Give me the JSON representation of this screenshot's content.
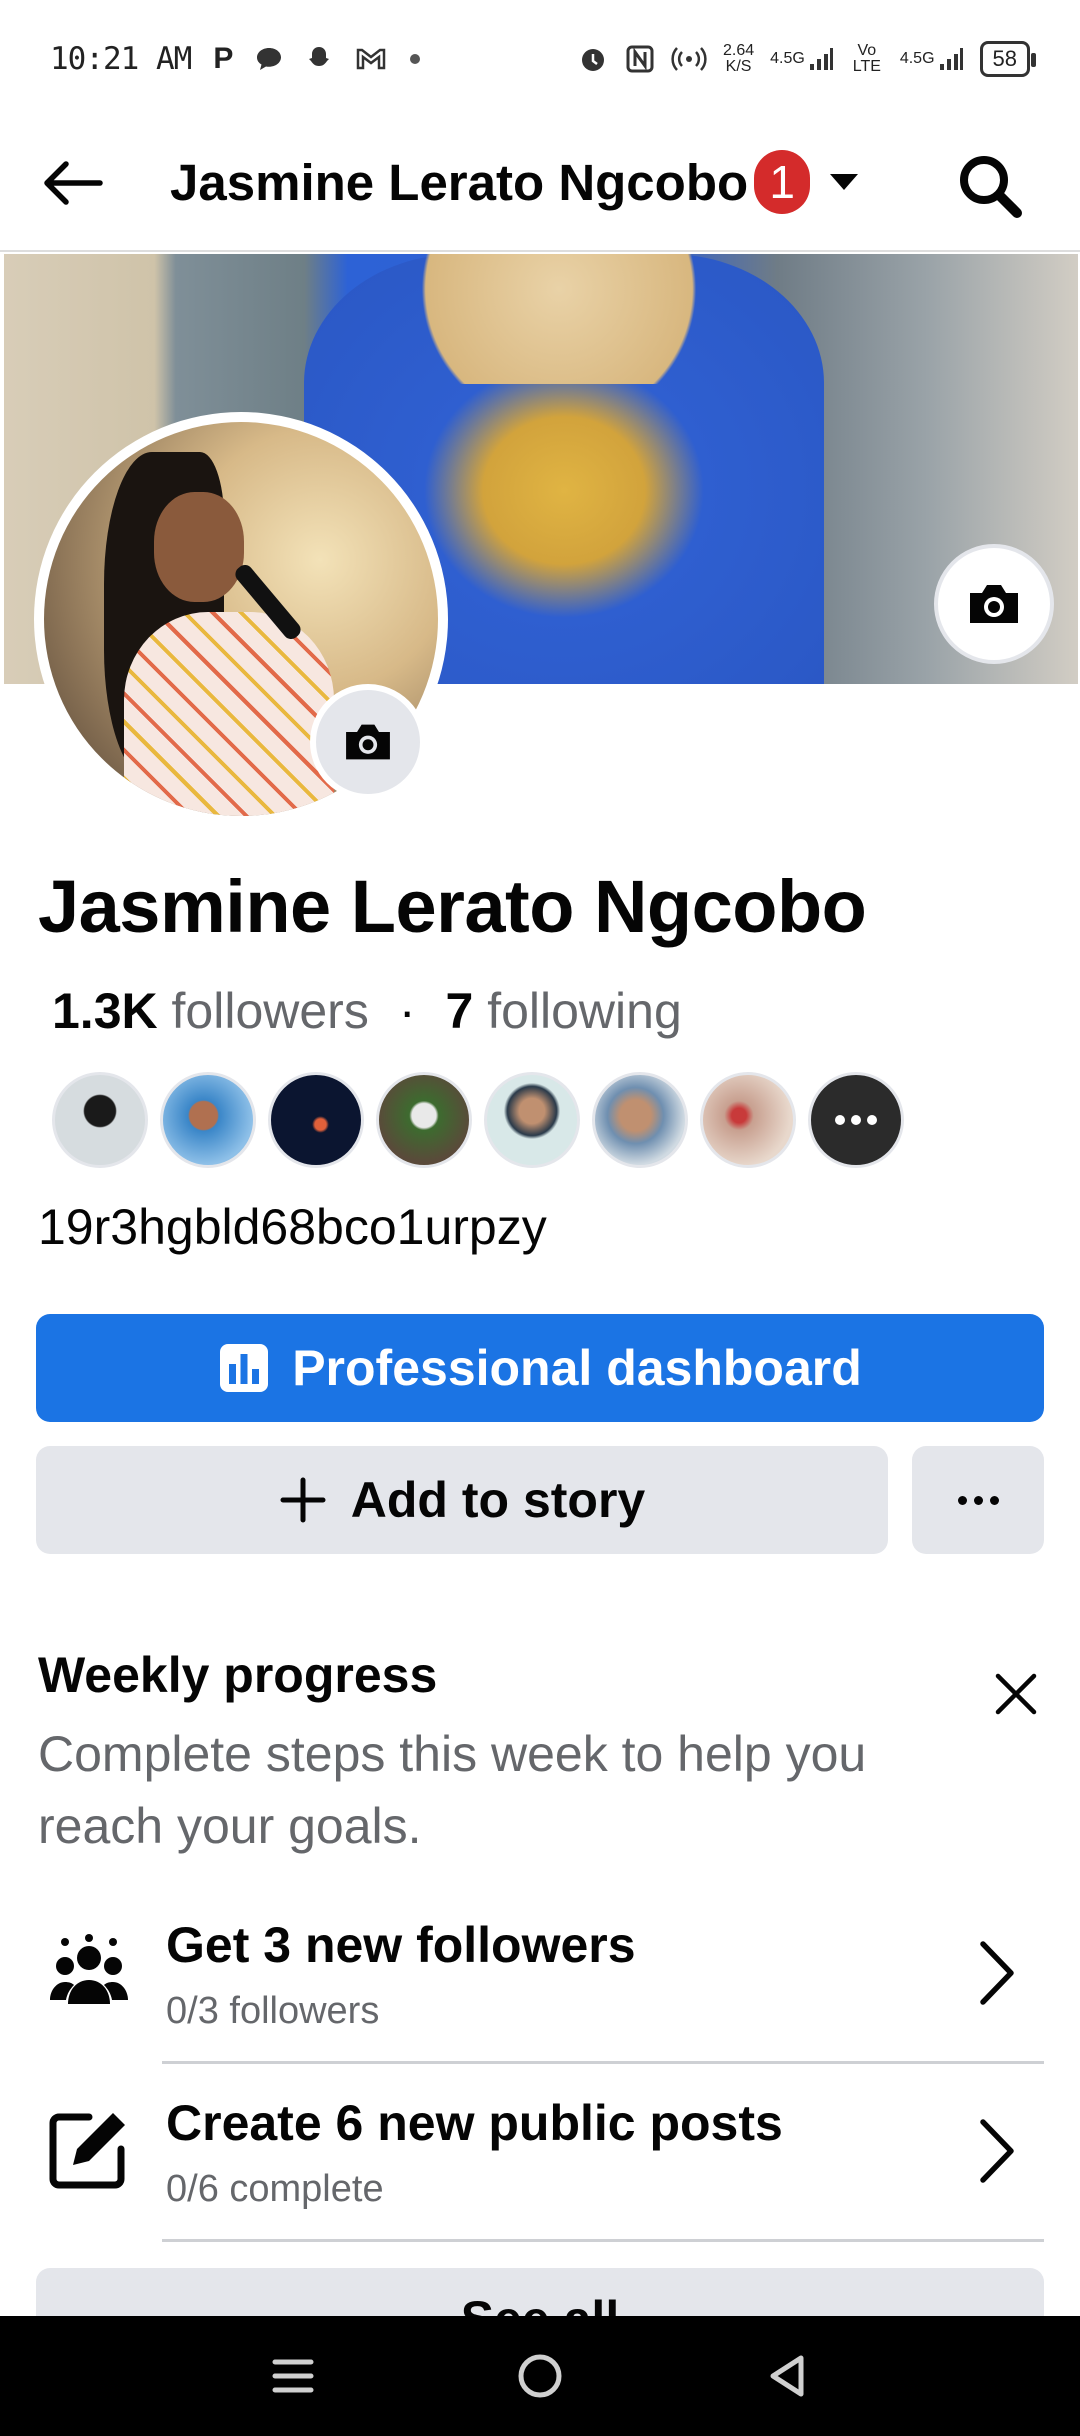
{
  "status_bar": {
    "time": "10:21 AM",
    "left_icons": [
      "P",
      "chat-bubble",
      "snapchat-ghost",
      "gmail",
      "dot"
    ],
    "speed_value": "2.64",
    "speed_unit": "K/S",
    "network_1": "4.5G",
    "volte": "Vo LTE",
    "network_2": "4.5G",
    "battery": "58"
  },
  "header": {
    "title": "Jasmine Lerato Ngcobo",
    "badge_count": "1"
  },
  "profile": {
    "name": "Jasmine Lerato Ngcobo",
    "followers_count": "1.3K",
    "followers_label": "followers",
    "separator": "·",
    "following_count": "7",
    "following_label": "following",
    "bio": "19r3hgbld68bco1urpzy"
  },
  "follower_avatars": [
    "#7d8a91",
    "#3a86c8",
    "#0b1530",
    "#5a4a3a",
    "#8ab4b0",
    "#6f8fb0",
    "#c8a090"
  ],
  "buttons": {
    "professional_dashboard": "Professional dashboard",
    "add_to_story": "Add to story",
    "see_all": "See all"
  },
  "weekly_progress": {
    "title": "Weekly progress",
    "description": "Complete steps this week to help you reach your goals.",
    "tasks": [
      {
        "title": "Get 3 new followers",
        "subtitle": "0/3 followers",
        "icon": "people-icon"
      },
      {
        "title": "Create 6 new public posts",
        "subtitle": "0/6 complete",
        "icon": "edit-icon"
      }
    ]
  },
  "colors": {
    "primary": "#1b74e4",
    "badge": "#d42b2b",
    "secondary_button": "#e4e6eb",
    "secondary_text": "#65676b"
  }
}
